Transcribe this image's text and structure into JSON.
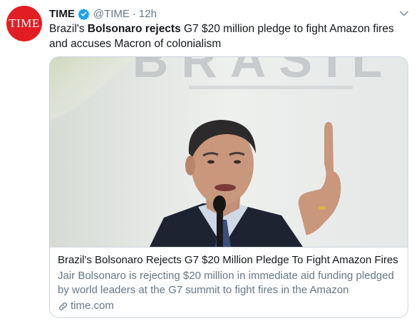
{
  "tweet": {
    "avatar_text": "TIME",
    "name": "TIME",
    "handle": "@TIME",
    "separator": "·",
    "time": "12h",
    "text_prefix": "Brazil's ",
    "text_bold": "Bolsonaro rejects",
    "text_suffix": " G7 $20 million pledge to fight Amazon fires and accuses Macron of colonialism"
  },
  "card": {
    "image_backdrop_text": "BRASIL",
    "title": "Brazil's Bolsonaro Rejects G7 $20 Million Pledge To Fight Amazon Fires",
    "description": "Jair Bolsonaro is rejecting $20 million in immediate aid funding pledged by world leaders at the G7 summit to fight fires in the Amazon",
    "domain": "time.com"
  },
  "colors": {
    "brand_red": "#e21d23",
    "verified_blue": "#1da1f2",
    "secondary_text": "#657786",
    "border": "#ccd6dd"
  },
  "icons": [
    "verified-badge-icon",
    "chevron-down-icon",
    "link-icon"
  ]
}
